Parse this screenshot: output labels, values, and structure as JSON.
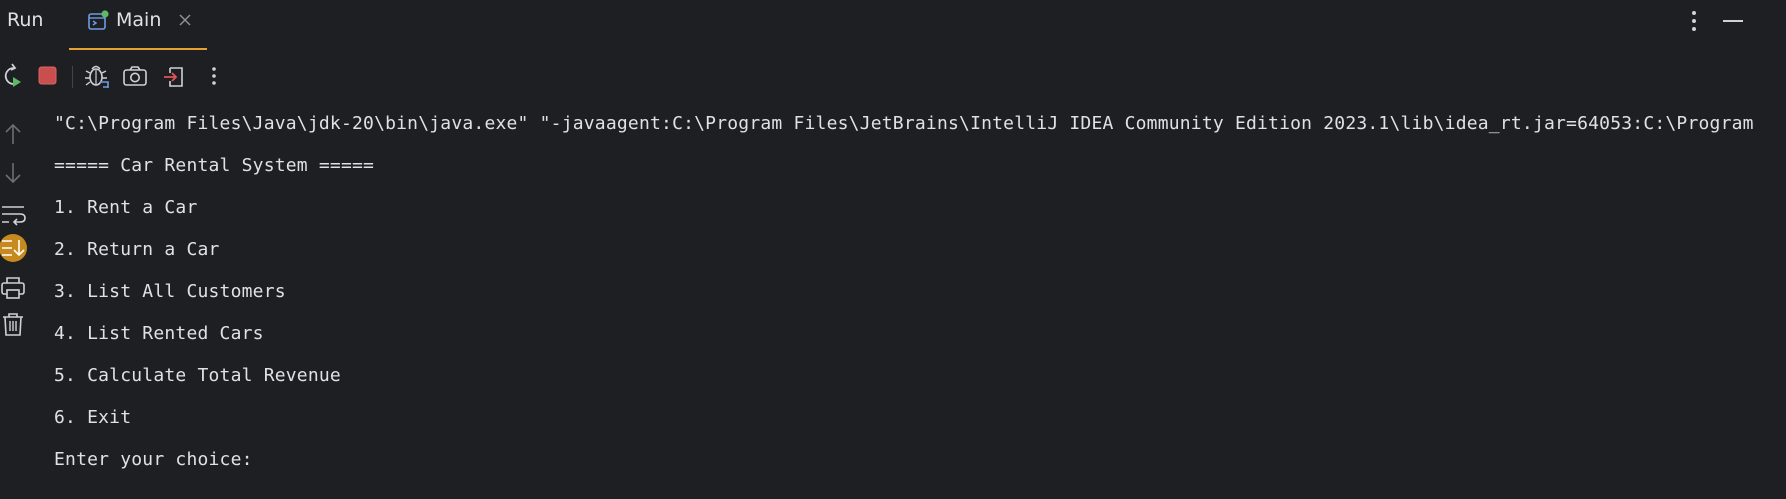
{
  "header": {
    "panel_title": "Run",
    "tab_label": "Main"
  },
  "colors": {
    "background": "#1e1f22",
    "text": "#dfe1e5",
    "tab_underline": "#e5a230",
    "stop_red": "#c94f4f",
    "running_dot": "#5fb865",
    "scroll_to_end_active": "#c78a1f"
  },
  "toolbar": {
    "icons": [
      "rerun-icon",
      "stop-icon",
      "debug-icon",
      "camera-icon",
      "exit-icon",
      "more-vertical-icon"
    ]
  },
  "gutter": {
    "icons": [
      "arrow-up-icon",
      "arrow-down-icon",
      "soft-wrap-icon",
      "scroll-to-end-icon",
      "print-icon",
      "trash-icon"
    ]
  },
  "console": {
    "lines": [
      "\"C:\\Program Files\\Java\\jdk-20\\bin\\java.exe\" \"-javaagent:C:\\Program Files\\JetBrains\\IntelliJ IDEA Community Edition 2023.1\\lib\\idea_rt.jar=64053:C:\\Program",
      "===== Car Rental System =====",
      "1. Rent a Car",
      "2. Return a Car",
      "3. List All Customers",
      "4. List Rented Cars",
      "5. Calculate Total Revenue",
      "6. Exit",
      "Enter your choice:"
    ]
  }
}
